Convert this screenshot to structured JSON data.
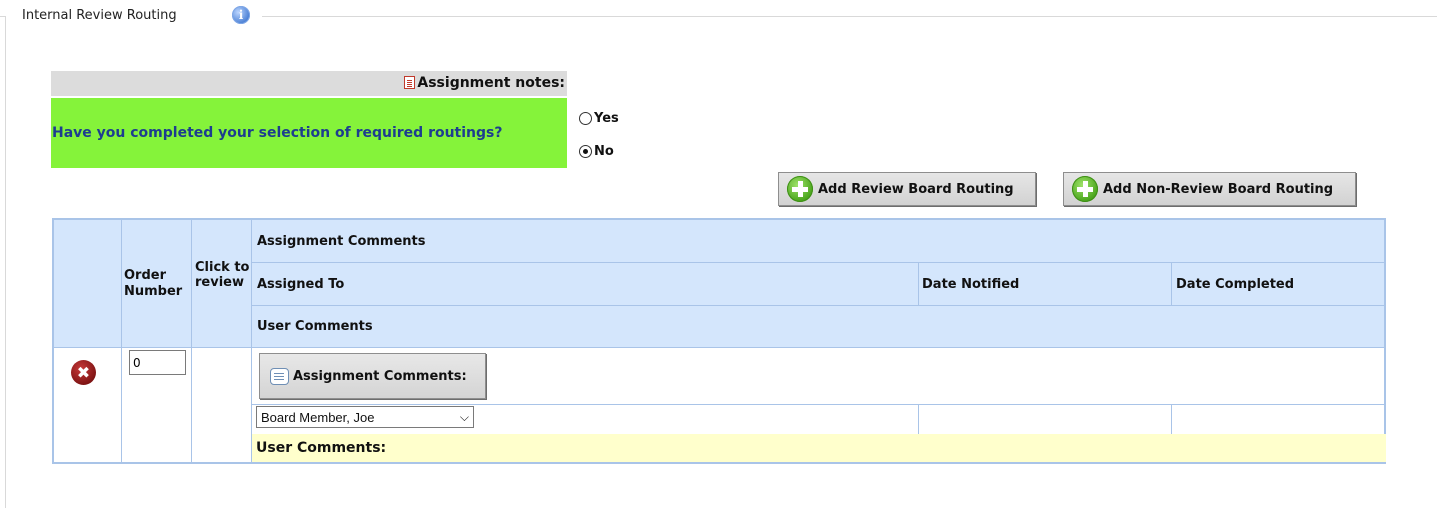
{
  "section": {
    "title": "Internal Review Routing",
    "info_icon": "i"
  },
  "notes": {
    "label": "Assignment notes:"
  },
  "question": {
    "text": "Have you completed your selection of required routings?",
    "options": [
      {
        "label": "Yes",
        "selected": false
      },
      {
        "label": "No",
        "selected": true
      }
    ]
  },
  "buttons": {
    "add_review_board": "Add Review Board Routing",
    "add_non_review_board": "Add Non-Review Board Routing"
  },
  "table": {
    "headers": {
      "order_number": "Order Number",
      "click_to_review": "Click to review",
      "assignment_comments": "Assignment Comments",
      "assigned_to": "Assigned To",
      "date_notified": "Date Notified",
      "date_completed": "Date Completed",
      "user_comments": "User Comments"
    },
    "rows": [
      {
        "delete_icon": "✖",
        "order_value": "0",
        "assignment_comments_button": "Assignment Comments:",
        "assigned_to": "Board Member, Joe",
        "date_notified": "",
        "date_completed": "",
        "user_comments_label": "User Comments:"
      }
    ]
  },
  "colors": {
    "question_bg": "#85f33a",
    "question_text": "#1d3d8f",
    "header_bg": "#d4e6fc",
    "user_comments_bg": "#ffffcc",
    "table_border": "#a9c4e8"
  }
}
